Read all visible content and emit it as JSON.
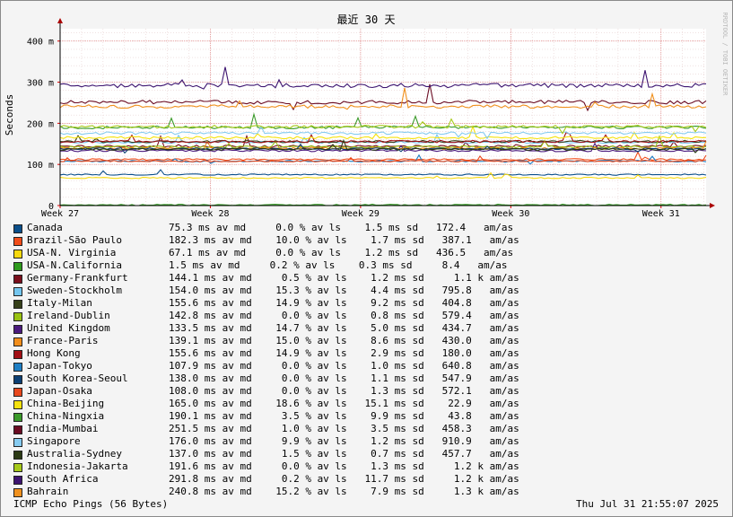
{
  "chart_data": {
    "type": "line",
    "title": "最近 30 天",
    "ylabel": "Seconds",
    "watermark": "RRDTOOL / TOBI OETIKER",
    "yticks": [
      {
        "value": 0,
        "label": "0"
      },
      {
        "value": 100,
        "label": "100 m"
      },
      {
        "value": 200,
        "label": "200 m"
      },
      {
        "value": 300,
        "label": "300 m"
      },
      {
        "value": 400,
        "label": "400 m"
      }
    ],
    "ylim": [
      0,
      430
    ],
    "xticks": [
      {
        "value": 0,
        "label": "Week 27"
      },
      {
        "value": 1,
        "label": "Week 28"
      },
      {
        "value": 2,
        "label": "Week 29"
      },
      {
        "value": 3,
        "label": "Week 30"
      },
      {
        "value": 4,
        "label": "Week 31"
      }
    ],
    "xlim": [
      0,
      4.3
    ],
    "grid": true,
    "series": [
      {
        "name": "Canada",
        "color": "#0b4f8a",
        "avg_ms": 75.3,
        "stats": "75.3 ms av md     0.0 % av ls    1.5 ms sd   172.4   am/as"
      },
      {
        "name": "Brazil-São Paulo",
        "color": "#f14d1a",
        "avg_ms": 182.3,
        "stats": "182.3 ms av md    10.0 % av ls    1.7 ms sd   387.1   am/as",
        "display_ms": 112
      },
      {
        "name": "USA-N. Virginia",
        "color": "#f7d90f",
        "avg_ms": 67.1,
        "stats": "67.1 ms av md     0.0 % av ls    1.2 ms sd   436.5   am/as"
      },
      {
        "name": "USA-N.California",
        "color": "#2f9b1e",
        "avg_ms": 1.5,
        "stats": "1.5 ms av md     0.2 % av ls    0.3 ms sd     8.4   am/as"
      },
      {
        "name": "Germany-Frankfurt",
        "color": "#7a0f1c",
        "avg_ms": 144.1,
        "stats": "144.1 ms av md     0.5 % av ls    1.2 ms sd     1.1 k am/as"
      },
      {
        "name": "Sweden-Stockholm",
        "color": "#74c6ef",
        "avg_ms": 154.0,
        "stats": "154.0 ms av md    15.3 % av ls    4.4 ms sd   795.8   am/as"
      },
      {
        "name": "Italy-Milan",
        "color": "#36401a",
        "avg_ms": 155.6,
        "stats": "155.6 ms av md    14.9 % av ls    9.2 ms sd   404.8   am/as"
      },
      {
        "name": "Ireland-Dublin",
        "color": "#9ac313",
        "avg_ms": 142.8,
        "stats": "142.8 ms av md     0.0 % av ls    0.8 ms sd   579.4   am/as"
      },
      {
        "name": "United Kingdom",
        "color": "#4b1a7d",
        "avg_ms": 133.5,
        "stats": "133.5 ms av md    14.7 % av ls    5.0 ms sd   434.7   am/as"
      },
      {
        "name": "France-Paris",
        "color": "#f28e1c",
        "avg_ms": 139.1,
        "stats": "139.1 ms av md    15.0 % av ls    8.6 ms sd   430.0   am/as"
      },
      {
        "name": "Hong Kong",
        "color": "#a20f15",
        "avg_ms": 155.6,
        "stats": "155.6 ms av md    14.9 % av ls    2.9 ms sd   180.0   am/as"
      },
      {
        "name": "Japan-Tokyo",
        "color": "#1f7fc4",
        "avg_ms": 107.9,
        "stats": "107.9 ms av md     0.0 % av ls    1.0 ms sd   640.8   am/as"
      },
      {
        "name": "South Korea-Seoul",
        "color": "#0c3f73",
        "avg_ms": 138.0,
        "stats": "138.0 ms av md     0.0 % av ls    1.1 ms sd   547.9   am/as"
      },
      {
        "name": "Japan-Osaka",
        "color": "#e8481d",
        "avg_ms": 108.0,
        "stats": "108.0 ms av md     0.0 % av ls    1.3 ms sd   572.1   am/as"
      },
      {
        "name": "China-Beijing",
        "color": "#f5e20d",
        "avg_ms": 165.0,
        "stats": "165.0 ms av md    18.6 % av ls   15.1 ms sd    22.9   am/as"
      },
      {
        "name": "China-Ningxia",
        "color": "#3b9a2a",
        "avg_ms": 190.1,
        "stats": "190.1 ms av md     3.5 % av ls    9.9 ms sd    43.8   am/as"
      },
      {
        "name": "India-Mumbai",
        "color": "#6a0b22",
        "avg_ms": 251.5,
        "stats": "251.5 ms av md     1.0 % av ls    3.5 ms sd   458.3   am/as"
      },
      {
        "name": "Singapore",
        "color": "#86cbf0",
        "avg_ms": 176.0,
        "stats": "176.0 ms av md     9.9 % av ls    1.2 ms sd   910.9   am/as"
      },
      {
        "name": "Australia-Sydney",
        "color": "#2b3a14",
        "avg_ms": 137.0,
        "stats": "137.0 ms av md     1.5 % av ls    0.7 ms sd   457.7   am/as"
      },
      {
        "name": "Indonesia-Jakarta",
        "color": "#a6c91a",
        "avg_ms": 191.6,
        "stats": "191.6 ms av md     0.0 % av ls    1.3 ms sd     1.2 k am/as"
      },
      {
        "name": "South Africa",
        "color": "#3d1470",
        "avg_ms": 291.8,
        "stats": "291.8 ms av md     0.2 % av ls   11.7 ms sd     1.2 k am/as"
      },
      {
        "name": "Bahrain",
        "color": "#f0911e",
        "avg_ms": 240.8,
        "stats": "240.8 ms av md    15.2 % av ls    7.9 ms sd     1.3 k am/as"
      }
    ]
  },
  "footer": {
    "left": "ICMP Echo Pings (56 Bytes)",
    "right": "Thu Jul 31 21:55:07 2025"
  }
}
